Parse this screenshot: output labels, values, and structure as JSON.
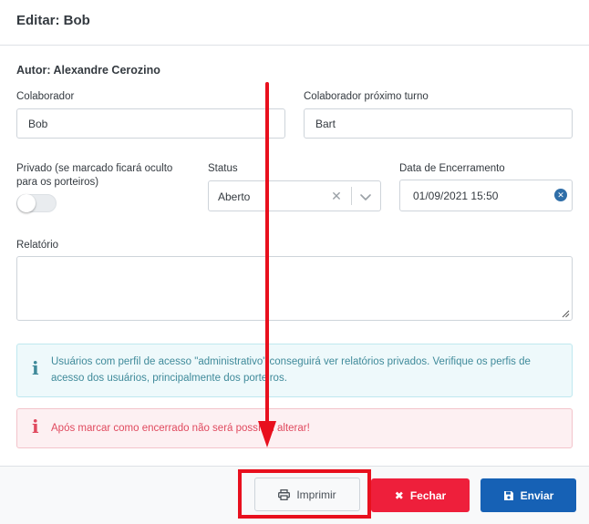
{
  "modal": {
    "title": "Editar: Bob",
    "author": "Autor: Alexandre Cerozino"
  },
  "form": {
    "colaborador": {
      "label": "Colaborador",
      "value": "Bob"
    },
    "proximo_turno": {
      "label": "Colaborador próximo turno",
      "value": "Bart"
    },
    "privado": {
      "label": "Privado (se marcado ficará oculto para os porteiros)",
      "checked": false
    },
    "status": {
      "label": "Status",
      "value": "Aberto"
    },
    "encerramento": {
      "label": "Data de Encerramento",
      "value": "01/09/2021 15:50"
    },
    "relatorio": {
      "label": "Relatório",
      "value": ""
    }
  },
  "alerts": {
    "info": "Usuários com perfil de acesso \"administrativo\" conseguirá ver relatórios privados. Verifique os perfis de acesso dos usuários, principalmente dos porteiros.",
    "danger": "Após marcar como encerrado não será possível alterar!"
  },
  "footer": {
    "print_label": "Imprimir",
    "close_label": "Fechar",
    "send_label": "Enviar"
  },
  "colors": {
    "close_button": "#ee1f3b",
    "send_button": "#1661b5",
    "annotation": "#e8101e"
  },
  "icons": {
    "info": "info-icon",
    "danger": "info-icon",
    "print": "printer-icon",
    "close": "times-icon",
    "send": "save-icon",
    "clear": "times-icon",
    "chevron": "chevron-down-icon"
  }
}
